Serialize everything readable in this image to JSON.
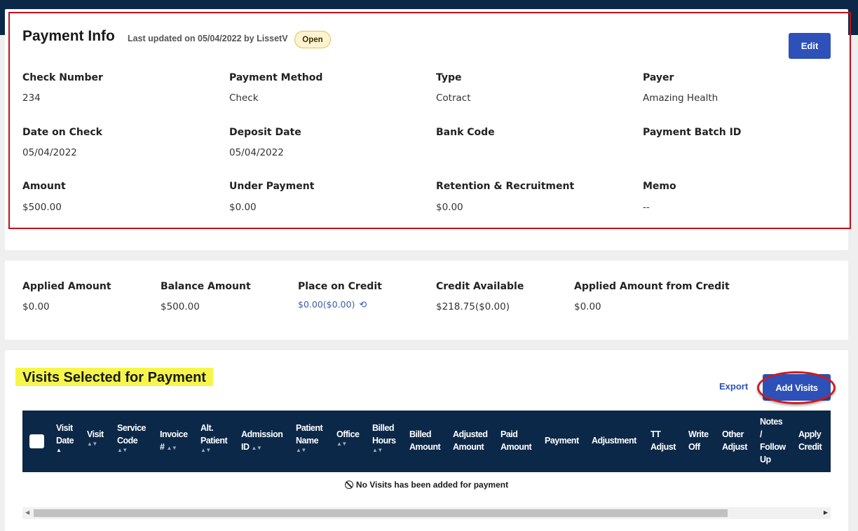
{
  "payment_info": {
    "title": "Payment Info",
    "last_updated": "Last updated on 05/04/2022 by LissetV",
    "status": "Open",
    "edit_label": "Edit",
    "fields": [
      {
        "label": "Check Number",
        "value": "234"
      },
      {
        "label": "Payment Method",
        "value": "Check"
      },
      {
        "label": "Type",
        "value": "Cotract"
      },
      {
        "label": "Payer",
        "value": "Amazing Health"
      },
      {
        "label": "Date on Check",
        "value": "05/04/2022"
      },
      {
        "label": "Deposit Date",
        "value": "05/04/2022"
      },
      {
        "label": "Bank Code",
        "value": ""
      },
      {
        "label": "Payment Batch ID",
        "value": ""
      },
      {
        "label": "Amount",
        "value": "$500.00"
      },
      {
        "label": "Under Payment",
        "value": "$0.00"
      },
      {
        "label": "Retention & Recruitment",
        "value": "$0.00"
      },
      {
        "label": "Memo",
        "value": "--"
      }
    ]
  },
  "summary": {
    "fields": [
      {
        "label": "Applied Amount",
        "value": "$0.00"
      },
      {
        "label": "Balance Amount",
        "value": "$500.00"
      },
      {
        "label": "Place on Credit",
        "value": "$0.00($0.00)"
      },
      {
        "label": "Credit Available",
        "value": "$218.75($0.00)"
      },
      {
        "label": "Applied Amount from Credit",
        "value": "$0.00"
      }
    ],
    "reset_icon": "history-icon"
  },
  "visits": {
    "title": "Visits Selected for Payment",
    "export_label": "Export",
    "add_label": "Add Visits",
    "columns": [
      "Visit\nDate",
      "Visit",
      "Service\nCode",
      "Invoice\n#",
      "Alt.\nPatient",
      "Admission\nID",
      "Patient\nName",
      "Office",
      "Billed\nHours",
      "Billed\nAmount",
      "Adjusted\nAmount",
      "Paid\nAmount",
      "Payment",
      "Adjustment",
      "TT\nAdjust",
      "Write\nOff",
      "Other\nAdjust",
      "Notes\n/\nFollow\nUp",
      "Apply\nCredit"
    ],
    "empty_message": "No Visits has been added for payment",
    "empty_icon": "ban-icon"
  },
  "colors": {
    "navy": "#0c2848",
    "primary": "#2d51b8",
    "highlight": "#f6f64a",
    "annotation_red": "#c0121b"
  }
}
